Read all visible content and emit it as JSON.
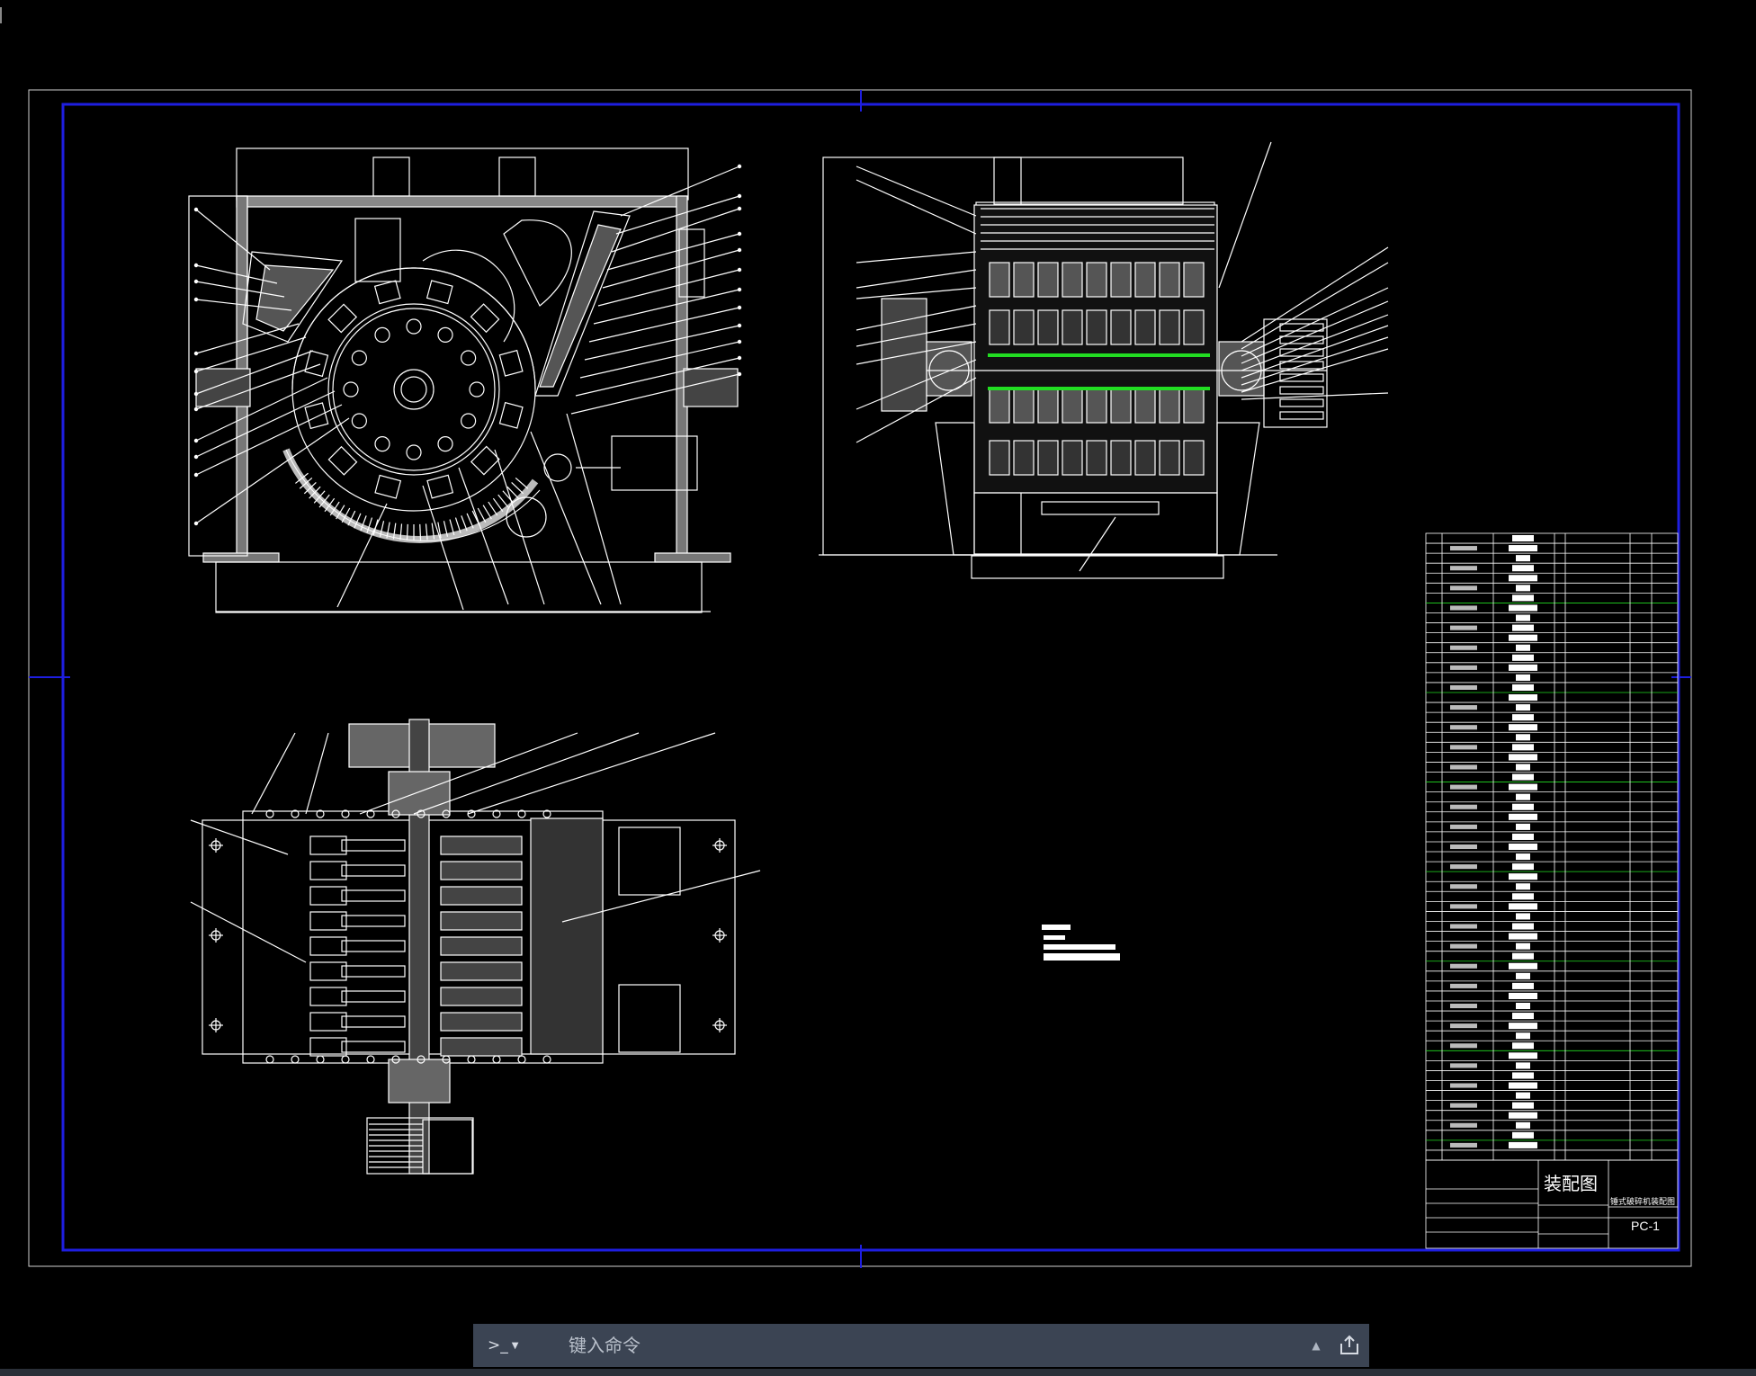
{
  "drawing": {
    "title": "装配图",
    "subtitle": "锤式破碎机装配图",
    "number": "PC-1"
  },
  "command_bar": {
    "prompt": ">_",
    "placeholder": "键入命令"
  },
  "icons": {
    "prompt": "terminal-prompt-icon",
    "dropdown": "chevron-down-icon",
    "history": "caret-up-icon",
    "share": "share-icon"
  },
  "colors": {
    "background": "#000000",
    "line": "#ffffff",
    "border": "#1e1ee0",
    "highlight": "#22dd22",
    "cmdbar": "#3b4453"
  }
}
